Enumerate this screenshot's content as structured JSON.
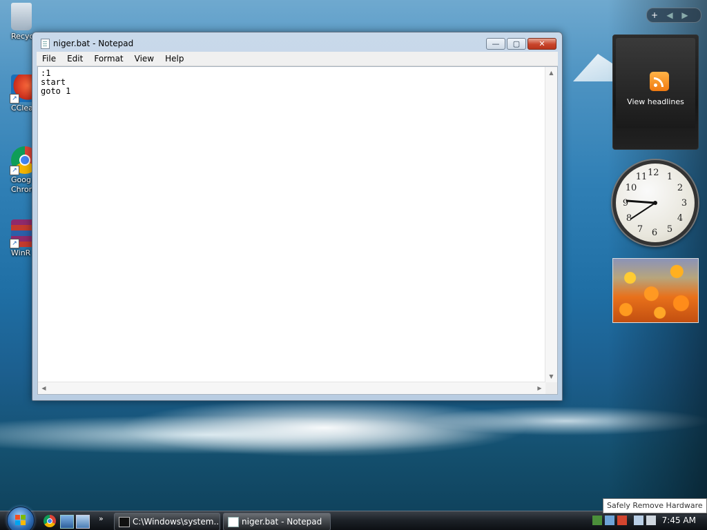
{
  "desktop": {
    "icons": [
      {
        "label": "Recycle"
      },
      {
        "label": "CClea"
      },
      {
        "label": "Goog\nChron"
      },
      {
        "label": "WinR"
      }
    ]
  },
  "notepad": {
    "title": "niger.bat - Notepad",
    "menu": [
      "File",
      "Edit",
      "Format",
      "View",
      "Help"
    ],
    "content": ":1\nstart\ngoto 1",
    "buttons": {
      "minimize": "—",
      "maximize": "▢",
      "close": "✕"
    }
  },
  "gadgets": {
    "toolbar": {
      "add": "+",
      "prev": "◀",
      "next": "▶"
    },
    "feed": {
      "label": "View headlines"
    },
    "clock": {
      "numbers": [
        "12",
        "1",
        "2",
        "3",
        "4",
        "5",
        "6",
        "7",
        "8",
        "9",
        "10",
        "11"
      ],
      "time_shown": "7:45"
    }
  },
  "taskbar": {
    "tasks": [
      {
        "label": "C:\\Windows\\system..."
      },
      {
        "label": "niger.bat - Notepad"
      }
    ],
    "quicklaunch_more": "»",
    "clock": "7:45 AM"
  },
  "tooltip": {
    "text": "Safely Remove Hardware"
  },
  "icons": {
    "start": "windows-orb-icon",
    "rss": "rss-feed-icon"
  }
}
